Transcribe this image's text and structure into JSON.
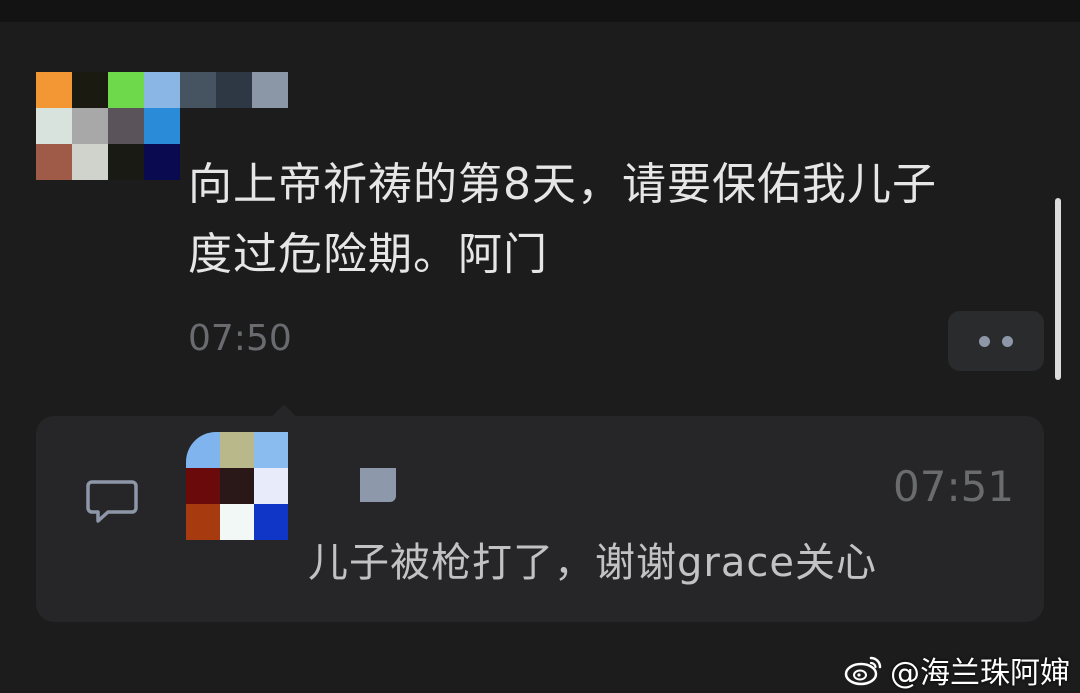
{
  "post": {
    "text_line1": "向上帝祈祷的第8天，请要保佑我儿子",
    "text_line2": "度过危险期。阿门",
    "time": "07:50"
  },
  "avatar_main_colors": [
    "#f39634",
    "#1a1a10",
    "#6ed94a",
    "#8ab6e6",
    "#d9e3de",
    "#a8a8a8",
    "#5a5359",
    "#2a8cd8",
    "#a05a48",
    "#d0d3cc",
    "#1a1a14",
    "#0a0a50"
  ],
  "name_blur_colors": [
    "#465361",
    "#2e3844",
    "#8b97a7"
  ],
  "comment": {
    "time": "07:51",
    "text": "儿子被枪打了，谢谢grace关心"
  },
  "avatar_comment_colors": [
    "#7fb4ee",
    "#b9b88a",
    "#8bbcf0",
    "#6a0a0a",
    "#2a1818",
    "#e8ecfa",
    "#a83a10",
    "#f2f8f6",
    "#1036c8"
  ],
  "watermark": {
    "text": "@海兰珠阿婶",
    "icon": "weibo-icon"
  },
  "colors": {
    "background": "#1c1c1d",
    "panel": "#262628",
    "text_primary": "#e6e6e6",
    "text_secondary": "#6a6b6e",
    "accent": "#8d97a8"
  }
}
